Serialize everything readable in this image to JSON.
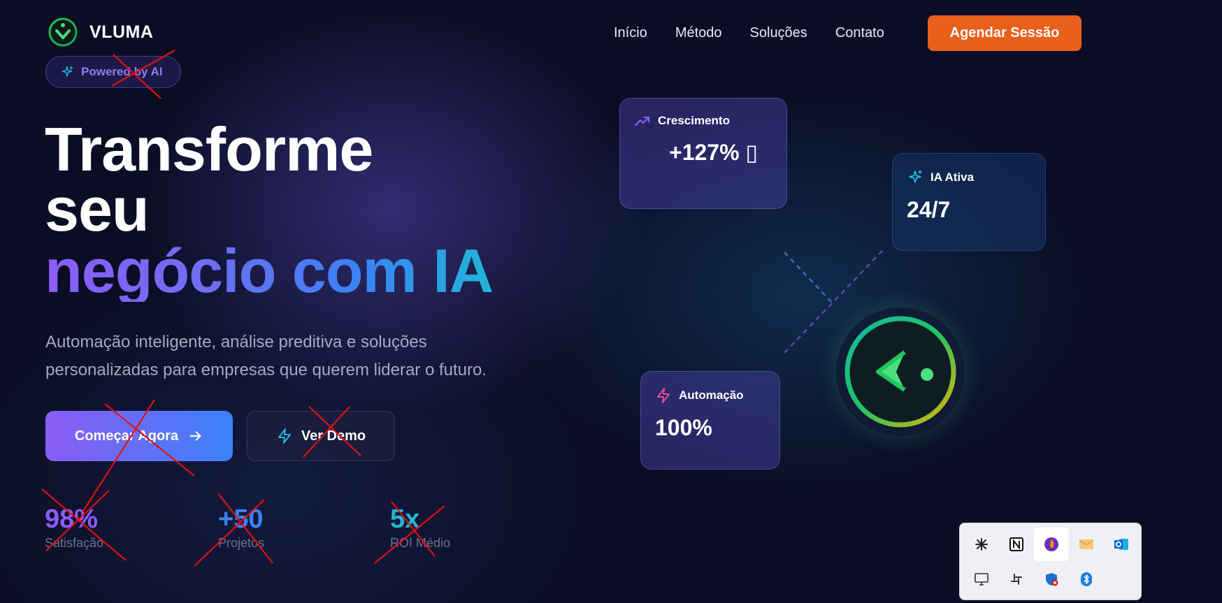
{
  "header": {
    "brand": "VLUMA",
    "nav": [
      "Início",
      "Método",
      "Soluções",
      "Contato"
    ],
    "cta": "Agendar Sessão"
  },
  "hero": {
    "badge": "Powered by AI",
    "title_line1": "Transforme",
    "title_line2": "seu",
    "title_line3": "negócio com IA",
    "subtitle_line1": "Automação inteligente, análise preditiva e soluções",
    "subtitle_line2": "personalizadas para empresas que querem liderar o futuro.",
    "primary_button": "Começar Agora",
    "secondary_button": "Ver Demo"
  },
  "stats": [
    {
      "value": "98%",
      "label": "Satisfação",
      "color": "#8b5cf6"
    },
    {
      "value": "+50",
      "label": "Projetos",
      "color": "#3b82f6"
    },
    {
      "value": "5x",
      "label": "ROI Médio",
      "color": "#1fb6d6"
    }
  ],
  "cards": {
    "growth": {
      "label": "Crescimento",
      "value": "+127% ▯",
      "icon": "trending-up-icon"
    },
    "ai": {
      "label": "IA Ativa",
      "value": "24/7",
      "icon": "sparkles-icon"
    },
    "automation": {
      "label": "Automação",
      "value": "100%",
      "icon": "zap-icon"
    }
  },
  "tray": {
    "icons": [
      "claude-icon",
      "notion-icon",
      "firefox-icon",
      "mail-icon",
      "outlook-icon",
      "display-icon",
      "slack-icon",
      "defender-icon",
      "bluetooth-icon"
    ]
  },
  "colors": {
    "accent_orange": "#e8601c",
    "gradient_start": "#8b5cf6",
    "gradient_end": "#3b82f6",
    "annotation_red": "#e01010"
  }
}
